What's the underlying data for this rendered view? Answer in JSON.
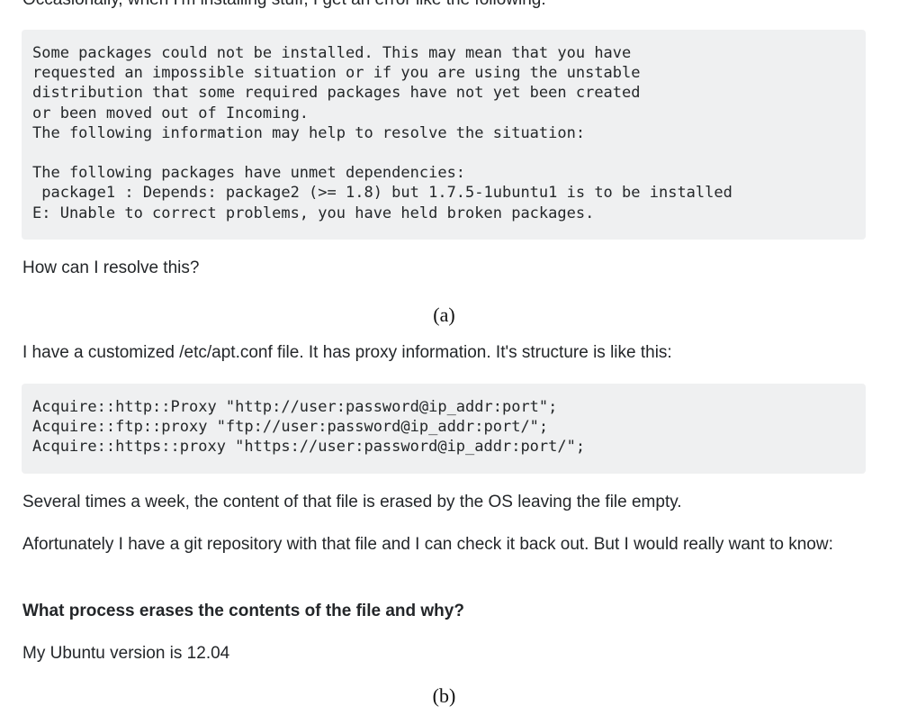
{
  "question_a": {
    "intro": "Occasionally, when I'm installing stuff, I get an error like the following:",
    "code_lines": [
      "Some packages could not be installed. This may mean that you have",
      "requested an impossible situation or if you are using the unstable",
      "distribution that some required packages have not yet been created",
      "or been moved out of Incoming.",
      "The following information may help to resolve the situation:",
      "",
      "The following packages have unmet dependencies:",
      " package1 : Depends: package2 (>= 1.8) but 1.7.5-1ubuntu1 is to be installed",
      "E: Unable to correct problems, you have held broken packages."
    ],
    "question": "How can I resolve this?",
    "caption": "(a)"
  },
  "question_b": {
    "intro": "I have a customized /etc/apt.conf file. It has proxy information. It's structure is like this:",
    "code_lines": [
      "Acquire::http::Proxy \"http://user:password@ip_addr:port\";",
      "Acquire::ftp::proxy \"ftp://user:password@ip_addr:port/\";",
      "Acquire::https::proxy \"https://user:password@ip_addr:port/\";"
    ],
    "para1": "Several times a week, the content of that file is erased by the OS leaving the file empty.",
    "para2": "Afortunately I have a git repository with that file and I can check it back out. But I would really want to know:",
    "bold_question": "What process erases the contents of the file and why?",
    "version": "My Ubuntu version is 12.04",
    "caption": "(b)"
  }
}
